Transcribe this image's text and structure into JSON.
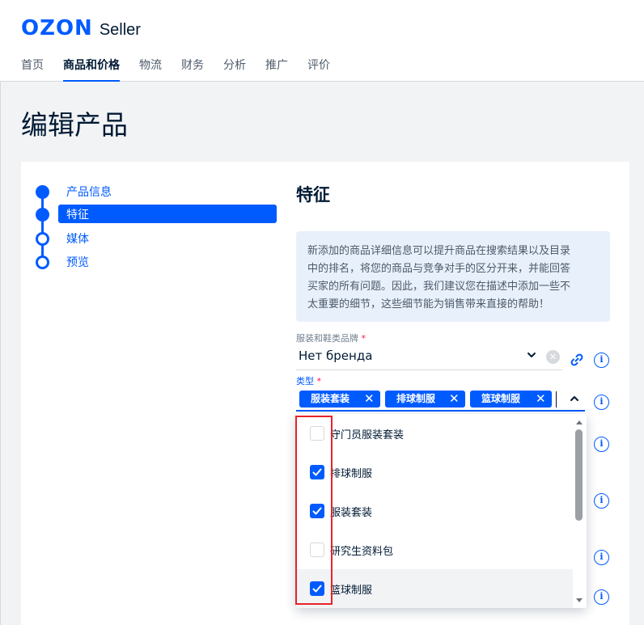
{
  "header": {
    "logo_ozon": "OZON",
    "logo_seller": "Seller",
    "nav": [
      {
        "label": "首页",
        "active": false
      },
      {
        "label": "商品和价格",
        "active": true
      },
      {
        "label": "物流",
        "active": false
      },
      {
        "label": "财务",
        "active": false
      },
      {
        "label": "分析",
        "active": false
      },
      {
        "label": "推广",
        "active": false
      },
      {
        "label": "评价",
        "active": false
      }
    ]
  },
  "page_title": "编辑产品",
  "steps": [
    {
      "label": "产品信息",
      "state": "done"
    },
    {
      "label": "特征",
      "state": "active"
    },
    {
      "label": "媒体",
      "state": "todo"
    },
    {
      "label": "预览",
      "state": "todo"
    }
  ],
  "section": {
    "title": "特征",
    "info_lines": [
      "新添加的商品详细信息可以提升商品在搜索结果以及目录",
      "中的排名，将您的商品与竞争对手的区分开来，并能回答",
      "买家的所有问题。因此，我们建议您在描述中添加一些不",
      "太重要的细节，这些细节能为销售带来直接的帮助！"
    ]
  },
  "brand_field": {
    "label": "服装和鞋类品牌",
    "required_mark": "*",
    "value": "Нет бренда",
    "clear_glyph": "✕"
  },
  "type_field": {
    "label": "类型",
    "required_mark": "*",
    "chips": [
      "服装套装",
      "排球制服",
      "篮球制服"
    ],
    "chip_remove_glyph": "✕"
  },
  "dropdown": {
    "options": [
      {
        "label": "守门员服装套装",
        "checked": false
      },
      {
        "label": "排球制服",
        "checked": true
      },
      {
        "label": "服装套装",
        "checked": true
      },
      {
        "label": "研究生资料包",
        "checked": false
      },
      {
        "label": "篮球制服",
        "checked": true
      }
    ]
  },
  "info_icon_glyph": "i",
  "colors": {
    "accent": "#005bff",
    "required": "#f91155",
    "highlight_box": "#e8232a",
    "info_bg": "#e8f0fb"
  }
}
